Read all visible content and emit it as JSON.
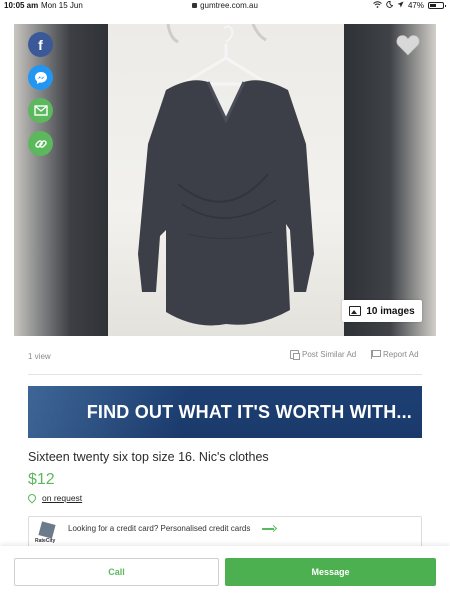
{
  "status_bar": {
    "time": "10:05 am",
    "date": "Mon 15 Jun",
    "url": "gumtree.com.au",
    "battery": "47%"
  },
  "gallery": {
    "image_count": "10 images",
    "share_icons": [
      "facebook-icon",
      "messenger-icon",
      "email-icon",
      "link-icon"
    ],
    "favourite_icon": "heart-icon"
  },
  "meta": {
    "views": "1 view",
    "post_similar": "Post Similar Ad",
    "report": "Report Ad"
  },
  "banner": {
    "text": "FIND OUT WHAT IT'S WORTH WITH..."
  },
  "listing": {
    "title": "Sixteen twenty six top size 16. Nic's clothes",
    "price": "$12",
    "location": "on request"
  },
  "promo": {
    "logo_text": "RateCity",
    "text": "Looking for a credit card? Personalised credit cards"
  },
  "actions": {
    "call": "Call",
    "message": "Message"
  },
  "colors": {
    "accent_green": "#5cb85c",
    "facebook_blue": "#3b5998",
    "messenger_blue": "#2196f3",
    "banner_navy": "#1d3f73"
  }
}
